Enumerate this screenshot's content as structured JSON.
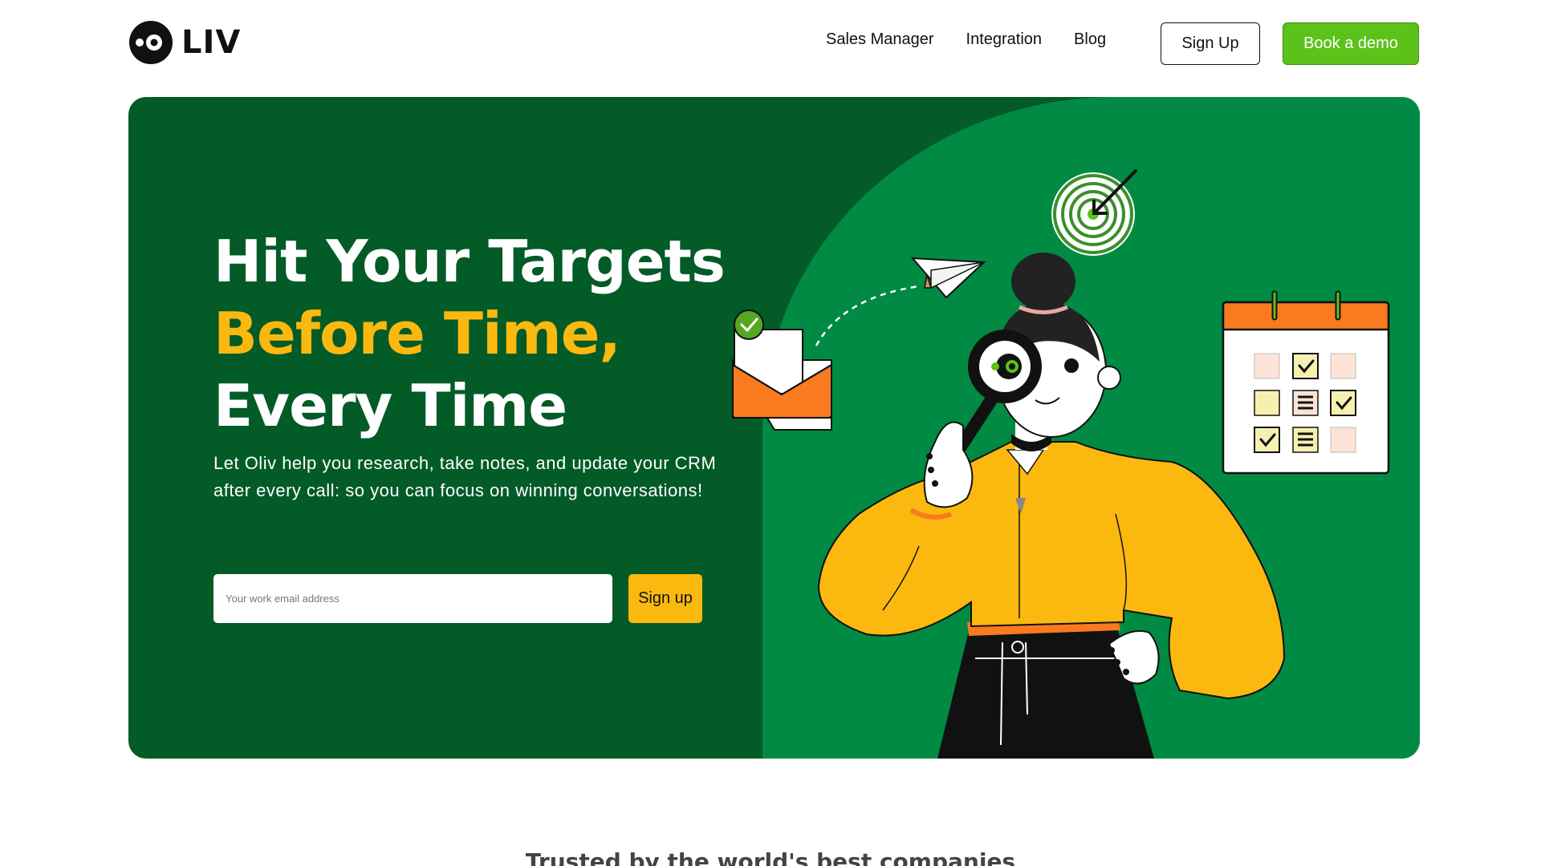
{
  "brand": {
    "name": "LIV",
    "accent": "#5cc21a",
    "dark_green": "#035b27",
    "mid_green": "#018a43",
    "yellow": "#fbb80f"
  },
  "nav": {
    "items": [
      {
        "label": "Sales Manager"
      },
      {
        "label": "Integration"
      },
      {
        "label": "Blog"
      }
    ],
    "signup_label": "Sign Up",
    "demo_label": "Book a demo"
  },
  "hero": {
    "title_line1": "Hit Your Targets",
    "title_line2": "Before Time,",
    "title_line3": "Every Time",
    "description": "Let Oliv help you research, take notes, and update your CRM after every call: so you can focus on winning conversations!",
    "email_placeholder": "Your work email address",
    "signup_label": "Sign up"
  },
  "trusted": {
    "heading": "Trusted by the world's best companies"
  },
  "icons": [
    "logo-mark-icon",
    "envelope-icon",
    "checkmark-icon",
    "paper-plane-icon",
    "target-icon",
    "calendar-icon",
    "magnifying-glass-icon"
  ]
}
